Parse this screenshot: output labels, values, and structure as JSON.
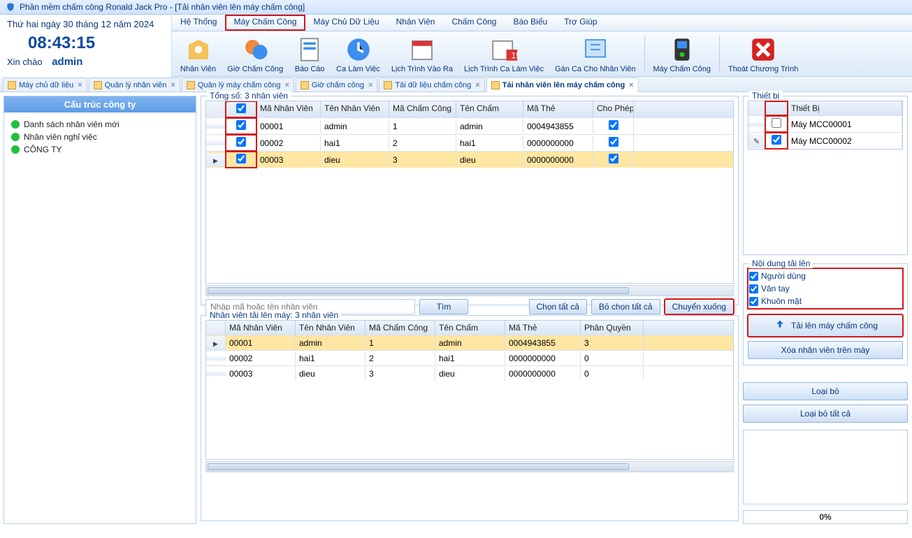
{
  "window": {
    "title": "Phần mềm chấm công Ronald Jack Pro - [Tải nhân viên lên máy chấm công]"
  },
  "info": {
    "date": "Thứ hai ngày 30 tháng 12 năm 2024",
    "clock": "08:43:15",
    "greeting": "Xin chào",
    "user": "admin"
  },
  "menu": {
    "items": [
      "Hệ Thống",
      "Máy Chấm Công",
      "Máy Chủ Dữ Liệu",
      "Nhân Viên",
      "Chấm Công",
      "Báo Biểu",
      "Trợ Giúp"
    ],
    "highlight": 1
  },
  "ribbon": [
    {
      "id": "employees",
      "label": "Nhân Viên"
    },
    {
      "id": "att-hours",
      "label": "Giờ Chấm Công"
    },
    {
      "id": "reports",
      "label": "Báo Cáo"
    },
    {
      "id": "shifts",
      "label": "Ca Làm Việc"
    },
    {
      "id": "inout-schedule",
      "label": "Lịch Trình Vào Ra"
    },
    {
      "id": "shift-schedule",
      "label": "Lịch Trình Ca Làm Việc"
    },
    {
      "id": "assign-shift",
      "label": "Gán Ca Cho Nhân Viên"
    },
    {
      "id": "device",
      "label": "Máy Chấm Công"
    },
    {
      "id": "exit",
      "label": "Thoát Chương Trình"
    }
  ],
  "tabs": [
    {
      "label": "Máy chủ dữ liệu",
      "active": false
    },
    {
      "label": "Quản lý nhân viên",
      "active": false
    },
    {
      "label": "Quản lý máy chấm công",
      "active": false
    },
    {
      "label": "Giờ chấm công",
      "active": false
    },
    {
      "label": "Tải dữ liệu chấm công",
      "active": false
    },
    {
      "label": "Tải nhân viên lên máy chấm công",
      "active": true
    }
  ],
  "tree": {
    "header": "Cấu trúc công ty",
    "nodes": [
      "Danh sách nhân viên mới",
      "Nhân viên nghỉ việc",
      "CÔNG TY"
    ]
  },
  "top_grid": {
    "legend": "Tổng số: 3 nhân viên",
    "cols": [
      "",
      "",
      "Mã Nhân Viên",
      "Tên Nhân Viên",
      "Mã Chấm Công",
      "Tên Chấm",
      "Mã Thẻ",
      "Cho Phép"
    ],
    "rows": [
      {
        "sel": false,
        "chk": true,
        "ma": "00001",
        "ten": "admin",
        "macc": "1",
        "tencc": "admin",
        "the": "0004943855",
        "perm": true
      },
      {
        "sel": false,
        "chk": true,
        "ma": "00002",
        "ten": "hai1",
        "macc": "2",
        "tencc": "hai1",
        "the": "0000000000",
        "perm": true
      },
      {
        "sel": true,
        "chk": true,
        "ma": "00003",
        "ten": "dieu",
        "macc": "3",
        "tencc": "dieu",
        "the": "0000000000",
        "perm": true
      }
    ]
  },
  "filter": {
    "placeholder": "Nhập mã hoặc tên nhân viên",
    "search": "Tìm",
    "selall": "Chọn tất cả",
    "deselall": "Bỏ chọn tất cả",
    "movedown": "Chuyển xuống"
  },
  "bot_grid": {
    "legend": "Nhân viên tải lên máy: 3 nhân viên",
    "cols": [
      "",
      "Mã Nhân Viên",
      "Tên Nhân Viên",
      "Mã Chấm Công",
      "Tên Chấm",
      "Mã Thẻ",
      "Phân Quyền"
    ],
    "rows": [
      {
        "sel": true,
        "ma": "00001",
        "ten": "admin",
        "macc": "1",
        "tencc": "admin",
        "the": "0004943855",
        "quyen": "3"
      },
      {
        "sel": false,
        "ma": "00002",
        "ten": "hai1",
        "macc": "2",
        "tencc": "hai1",
        "the": "0000000000",
        "quyen": "0"
      },
      {
        "sel": false,
        "ma": "00003",
        "ten": "dieu",
        "macc": "3",
        "tencc": "dieu",
        "the": "0000000000",
        "quyen": "0"
      }
    ]
  },
  "devices": {
    "legend": "Thiết bị",
    "col": "Thiết Bị",
    "rows": [
      {
        "chk": false,
        "name": "Máy MCC00001",
        "edit": false
      },
      {
        "chk": true,
        "name": "Máy MCC00002",
        "edit": true
      }
    ]
  },
  "uploadopts": {
    "legend": "Nội dung tải lên",
    "items": [
      {
        "label": "Người dùng",
        "chk": true
      },
      {
        "label": "Vân tay",
        "chk": true
      },
      {
        "label": "Khuôn mặt",
        "chk": true
      }
    ]
  },
  "actions": {
    "upload": "Tải lên máy chấm công",
    "deldev": "Xóa nhân viên trên máy",
    "remove": "Loại bỏ",
    "removeall": "Loại bỏ tất cả"
  },
  "progress": "0%"
}
